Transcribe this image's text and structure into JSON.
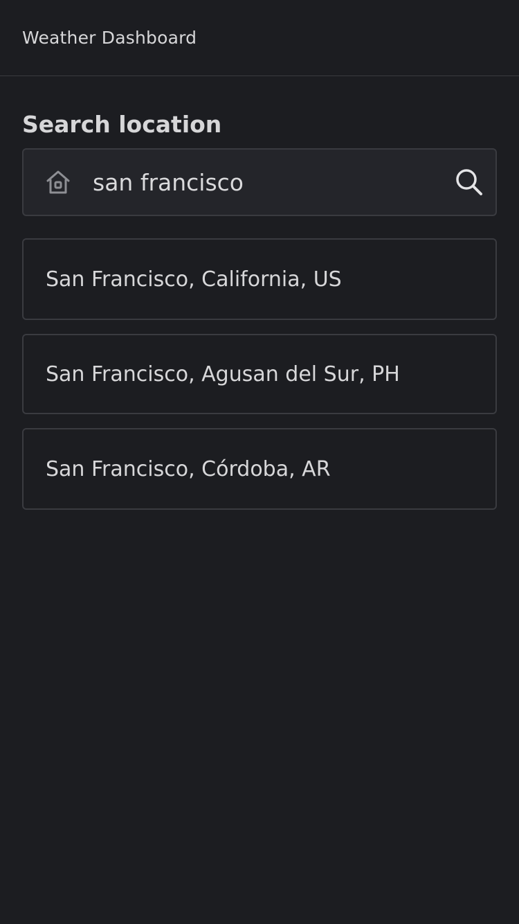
{
  "header": {
    "title": "Weather Dashboard"
  },
  "search": {
    "section_title": "Search location",
    "query": "san francisco",
    "placeholder": "",
    "home_icon": "home-icon",
    "search_icon": "search-icon"
  },
  "results": [
    {
      "label": "San Francisco, California, US"
    },
    {
      "label": "San Francisco, Agusan del Sur, PH"
    },
    {
      "label": "San Francisco, Córdoba, AR"
    }
  ],
  "colors": {
    "background": "#1c1d21",
    "surface": "#24252a",
    "border": "#3a3b40",
    "text": "#d7d7d9"
  }
}
